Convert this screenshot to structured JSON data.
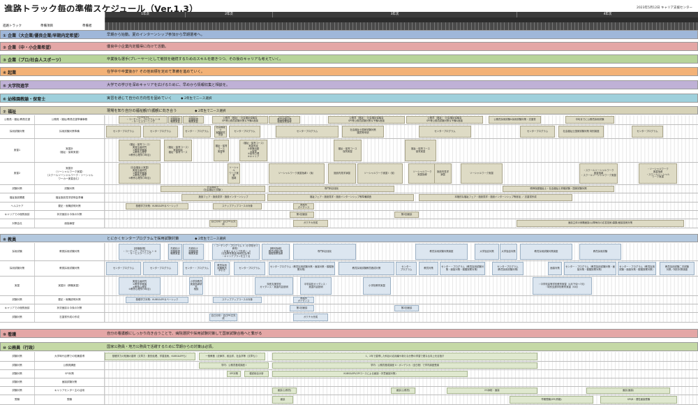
{
  "title": "進路トラック毎の準備スケジュール（Ver.1.3）",
  "meta": "2023年5月12日  キャリア支援センター",
  "header": {
    "left_cols": [
      "進路トラック",
      "準備項目",
      "準備者"
    ],
    "years": [
      "1年次",
      "2年次",
      "3年次",
      "4年次"
    ]
  },
  "sections": {
    "s1": {
      "title": "① 企業（大企業/優良企業/早期内定希望）",
      "desc": "早期から始動。夏のインターンシップ参加から早期選考へ。",
      "color": "#9fb7d9"
    },
    "s2": {
      "title": "② 企業（中・小企業希望）",
      "desc": "優良中小企業内定獲得に向けて活動。",
      "color": "#e4a7a6"
    },
    "s3": {
      "title": "③ 企業（プロ/社会人スポーツ）",
      "desc": "卒業後も選手(プレーヤー)として競技を継続するためのスキルを磨きつつ、その後のキャリアも考えていく。",
      "color": "#b7d49a"
    },
    "s4": {
      "title": "④ 起業",
      "desc": "在学中や卒業後か？その他目標を定めて準備を進めていく。",
      "color": "#f3b277"
    },
    "s5": {
      "title": "⑤ 大学院進学",
      "desc": "大学での学びを深めキャリアを広げるために、早めから情報収集と相談を。",
      "color": "#bfb1d6"
    },
    "s6": {
      "title": "⑥ 幼稚園教諭・保育士",
      "desc": "実習を通じて自分の方向性を固めていく",
      "note": "◆ 2年生で二ース選択",
      "color": "#9fd0dc"
    },
    "s7": {
      "title": "⑦ 福祉",
      "desc": "現場を知り自分の福祉観/介護観に向き合う",
      "note": "◆ 2年生で二ース選択",
      "color": "#d6d2b7"
    },
    "s8": {
      "title": "⑧ 教員",
      "desc": "とにかくセンタープログラムで採用試験対策",
      "note": "◆ 2年生で二ース選択",
      "color": "#b3c8de"
    },
    "s9": {
      "title": "⑨ 看護",
      "desc": "自分の看護観にしっかり向き合うことで、病院選択や採用試験対策して国家試験合格へと繋がる",
      "color": "#e4a7a6"
    },
    "s10": {
      "title": "⑩ 公務員（行政）",
      "desc": "国家公務員・地方公務員で活躍するために早期からの対策は必須。",
      "color": "#c5d9a6"
    }
  },
  "welfare": {
    "rows": [
      {
        "l": "公務員・福祉/教員志望",
        "m": "公務員・福祉/教員志望準備事務",
        "blocks": [
          "【資格取得】\n・コーチング・プログラム I・II\n・サービスラーニング",
          "先鋭化け\n資格取得\n職業実習",
          "先鋭化け\n資格取得\n職業実習",
          "公務員（福祉）・社会福祉協議会\nSPI等公務員試験対策＆予備&面接",
          "【教科指導】\n教員試験対策\n模擬授業指導",
          "公務員（福祉）・社会福祉協議会\nSPI等公務員試験対策＆予備&面接",
          "公務員（福祉）・社会福祉協議会\nSPI等公務員試験対策＆予備&面接",
          "公務員採用試験&採用試験対策・志望書",
          "中旬までに公務員採用試験"
        ]
      },
      {
        "l": "採用試験対策",
        "m": "採用試験対策準備",
        "blocks": [
          "センタープログラム",
          "センタープログラム",
          "センター・プログラム",
          "社会福祉士\n実験研究\n学部",
          "センタープログラム",
          "センタープログラム",
          "社会福祉士国家試験対策\n願書等申請",
          "センタープログラム",
          "センタープログラム",
          "社会福祉士国家試験対策 特別講座",
          "センタープログラム"
        ]
      },
      {
        "l": "実習1",
        "m": "実習計\n（福祉・保育実習）",
        "blocks": [
          "（福祉・保育コース）\n実習企画研究\n①教育学概論\n②教育心理学\n③教育心理学(3年目)",
          "（福祉・保育コース）\n実習相談\n福祉・保育コース",
          "福祉・保育\nコース\n実習等\nI",
          "（福祉・保育コース）\n実習専攻\n①体験活動\n②実習\n③保育心理\n④キャリア",
          "福祉・保育コース\n保育実習",
          "福祉・保育コース\n保育実習"
        ]
      },
      {
        "l": "実習2",
        "m": "実習計\n（ソーシャルワーク実習）\n（スクールソーシャルワーク・ソーシャル\nワーカー実習含む）",
        "blocks": [
          "（社会福祉士実習）\n実習企画研究\n①教育学概論\n②教育心理学\n③教育心理学(3年目)",
          "ソーシャル\nワーク実習\n指導",
          "ソーシャルワーク実習指導 I（後）",
          "施設内見学演習",
          "ソーシャルワーク実習 I（前）",
          "ソーシャルワーク\n実習指導",
          "施設内見学\n演習",
          "ソーシャルワーク実習",
          "・スクールソーシャルワーク\n実習指導\n・スクールソーシャルワーク実習",
          "・ソーシャルワーク\n実習指導\n・スクールソーシャル\nワーク実習"
        ]
      },
      {
        "l": "試験対策",
        "m": "試験対策",
        "blocks": [
          "社会福祉士\n（社会福祉士試験 ）",
          "専門科目強化",
          "精神保健福祉士・社会福祉士資格試験・国家試験対策"
        ]
      },
      {
        "l": "福祉施設関連",
        "m": "福祉施設見学説明会準備",
        "blocks": [
          "施設フェア・施設見学・施設インターンシップ",
          "福祉フェア・施設見学・施設インターンシップ等準備調査",
          "本格的な福祉フェア・施設見学・施設インターンシップ等参加 ／ 志望書作成"
        ]
      },
      {
        "l": "ヘルスケア",
        "m": "要記・就職説明対策",
        "blocks": [
          "基礎学力対策：KUBS&SPI＆ベーシック",
          "ステップアップコースの対象",
          "進路別\nガイダンス"
        ]
      },
      {
        "l": "キャリアでの個別面談",
        "m": "状況面談＆今後の対策",
        "blocks": [
          "第1回面談",
          "第2回面談"
        ]
      },
      {
        "l": "対策会社",
        "m": "面接練習",
        "blocks": [
          "自己分析・自己PR文完成",
          "ガクチカ完成",
          "面談主体の就職面接(以降毎月の応答技術)募集/面接技術対策"
        ]
      }
    ]
  },
  "teacher": {
    "rows": [
      {
        "l": "採用試験",
        "m": "教員採用試験対策",
        "blocks": [
          "【資格取得】\n・コーチング・プログラム I・II\n・サービスラーニング",
          "先鋭化け\n資格取得\n職業実習",
          "先鋭化け\n資格取得\n職業実習",
          "・コーチング・プログラム II（小学校ゼミ教育）\n・仕事とキャリア形成 I・II\n（社会教育関連/地域社会/等）\n・キャリアプランを立てる",
          "【教科指導】\n教員試験対策\n模擬授業指導",
          "専門科目強化",
          "教員採用試験対策講座",
          "大学独自対策",
          "大学独自対策",
          "教員採用試験対策講座",
          "教員採用試験"
        ]
      },
      {
        "l": "採用試験対策",
        "m": "教員採用試験対策",
        "blocks": [
          "センタープログラム",
          "センタープログラム",
          "センター・プログラム",
          "教員採用\n試験教員\n手引き",
          "センタープログラム",
          "センタープログラム（教員採用試験対策・面接対策・模擬授業対策）",
          "教員採用試験教員養成対策",
          "センター\nプログラム",
          "教員対策",
          "センター・プログラム（教員採用試験対策・面接対策・模擬授業対策）",
          "センタープログラム\n（教員採用試験対策）",
          "面接対策",
          "センター・プログラム（教員採用試験対策・面接対策・模擬授業対策）",
          "センター・プログラム（教員採用\n試験・面接対策・模擬授業対策）",
          "教員採用試験二次試験\n対策／特別対策講座"
        ]
      },
      {
        "l": "実習",
        "m": "実習計（教職実習）",
        "blocks": [
          "実習企画研究\n①教育学概論\n②教育心理学\n③教育心理学(3年目)",
          "小学校教員\n実習指導研究\n相談",
          "特別支援学校\nガイダンス・実習内容説明",
          "中学高校ガイダンス・\n実習内容説明",
          "小学校教育実習",
          "・中学校高等学校教育実習（4月下旬〜7月）\n・特別支援学校教育実習（6月）"
        ]
      },
      {
        "l": "試験対策",
        "m": "要記・就職説明対策",
        "blocks": [
          "基礎学力対策：KUBS&SPI＆ベーシック",
          "ステップアップコースの対象",
          "進路別\nガイダンス"
        ]
      },
      {
        "l": "キャリアでの個別面談",
        "m": "状況面談＆今後の対策",
        "blocks": [
          "第1回面談",
          "第2回面談"
        ]
      },
      {
        "l": "試験対策",
        "m": "志望書作成の作成",
        "blocks": [
          "自己分析・自己PR文完成",
          "ガクチカ完成"
        ]
      }
    ]
  },
  "public": {
    "rows": [
      {
        "l": "試験対策",
        "m": "大学時代目標での知識習得",
        "blocks": [
          "基礎学力の知識の習得（文章力・数的処理、学習技術、KUBS&SPIも）",
          "一般教養（法律学、政治学、社会学等（文章も））",
          "1、2年で習得した科目の応用編や新たな分野の学習で更なる向上を目指す"
        ]
      },
      {
        "l": "試験対策",
        "m": "公務員講座",
        "blocks": [
          "学内：公務員養成講座 I",
          "学内：公務員養成講座 II・ポンデジカ（全日程）で学内講座受講"
        ]
      },
      {
        "l": "試験対策",
        "m": "SPI対策",
        "blocks": [
          "SPI対策",
          "模試総合分析",
          "KUBS&SPI(SPIコースによる面接・好意面接対策)"
        ]
      },
      {
        "l": "試験対策",
        "m": "面接試験対策",
        "blocks": []
      },
      {
        "l": "試験対策",
        "m": "キャリアセンター主の活用",
        "blocks": [
          "面談(公務員)",
          "面談(公務員)",
          "ES添削・面接",
          "面談(面接)"
        ]
      },
      {
        "l": "受験",
        "m": "受験",
        "blocks": [
          "面談",
          "早期受験(SPI/資格)",
          "SPI/B・適性面接受験"
        ]
      }
    ]
  }
}
